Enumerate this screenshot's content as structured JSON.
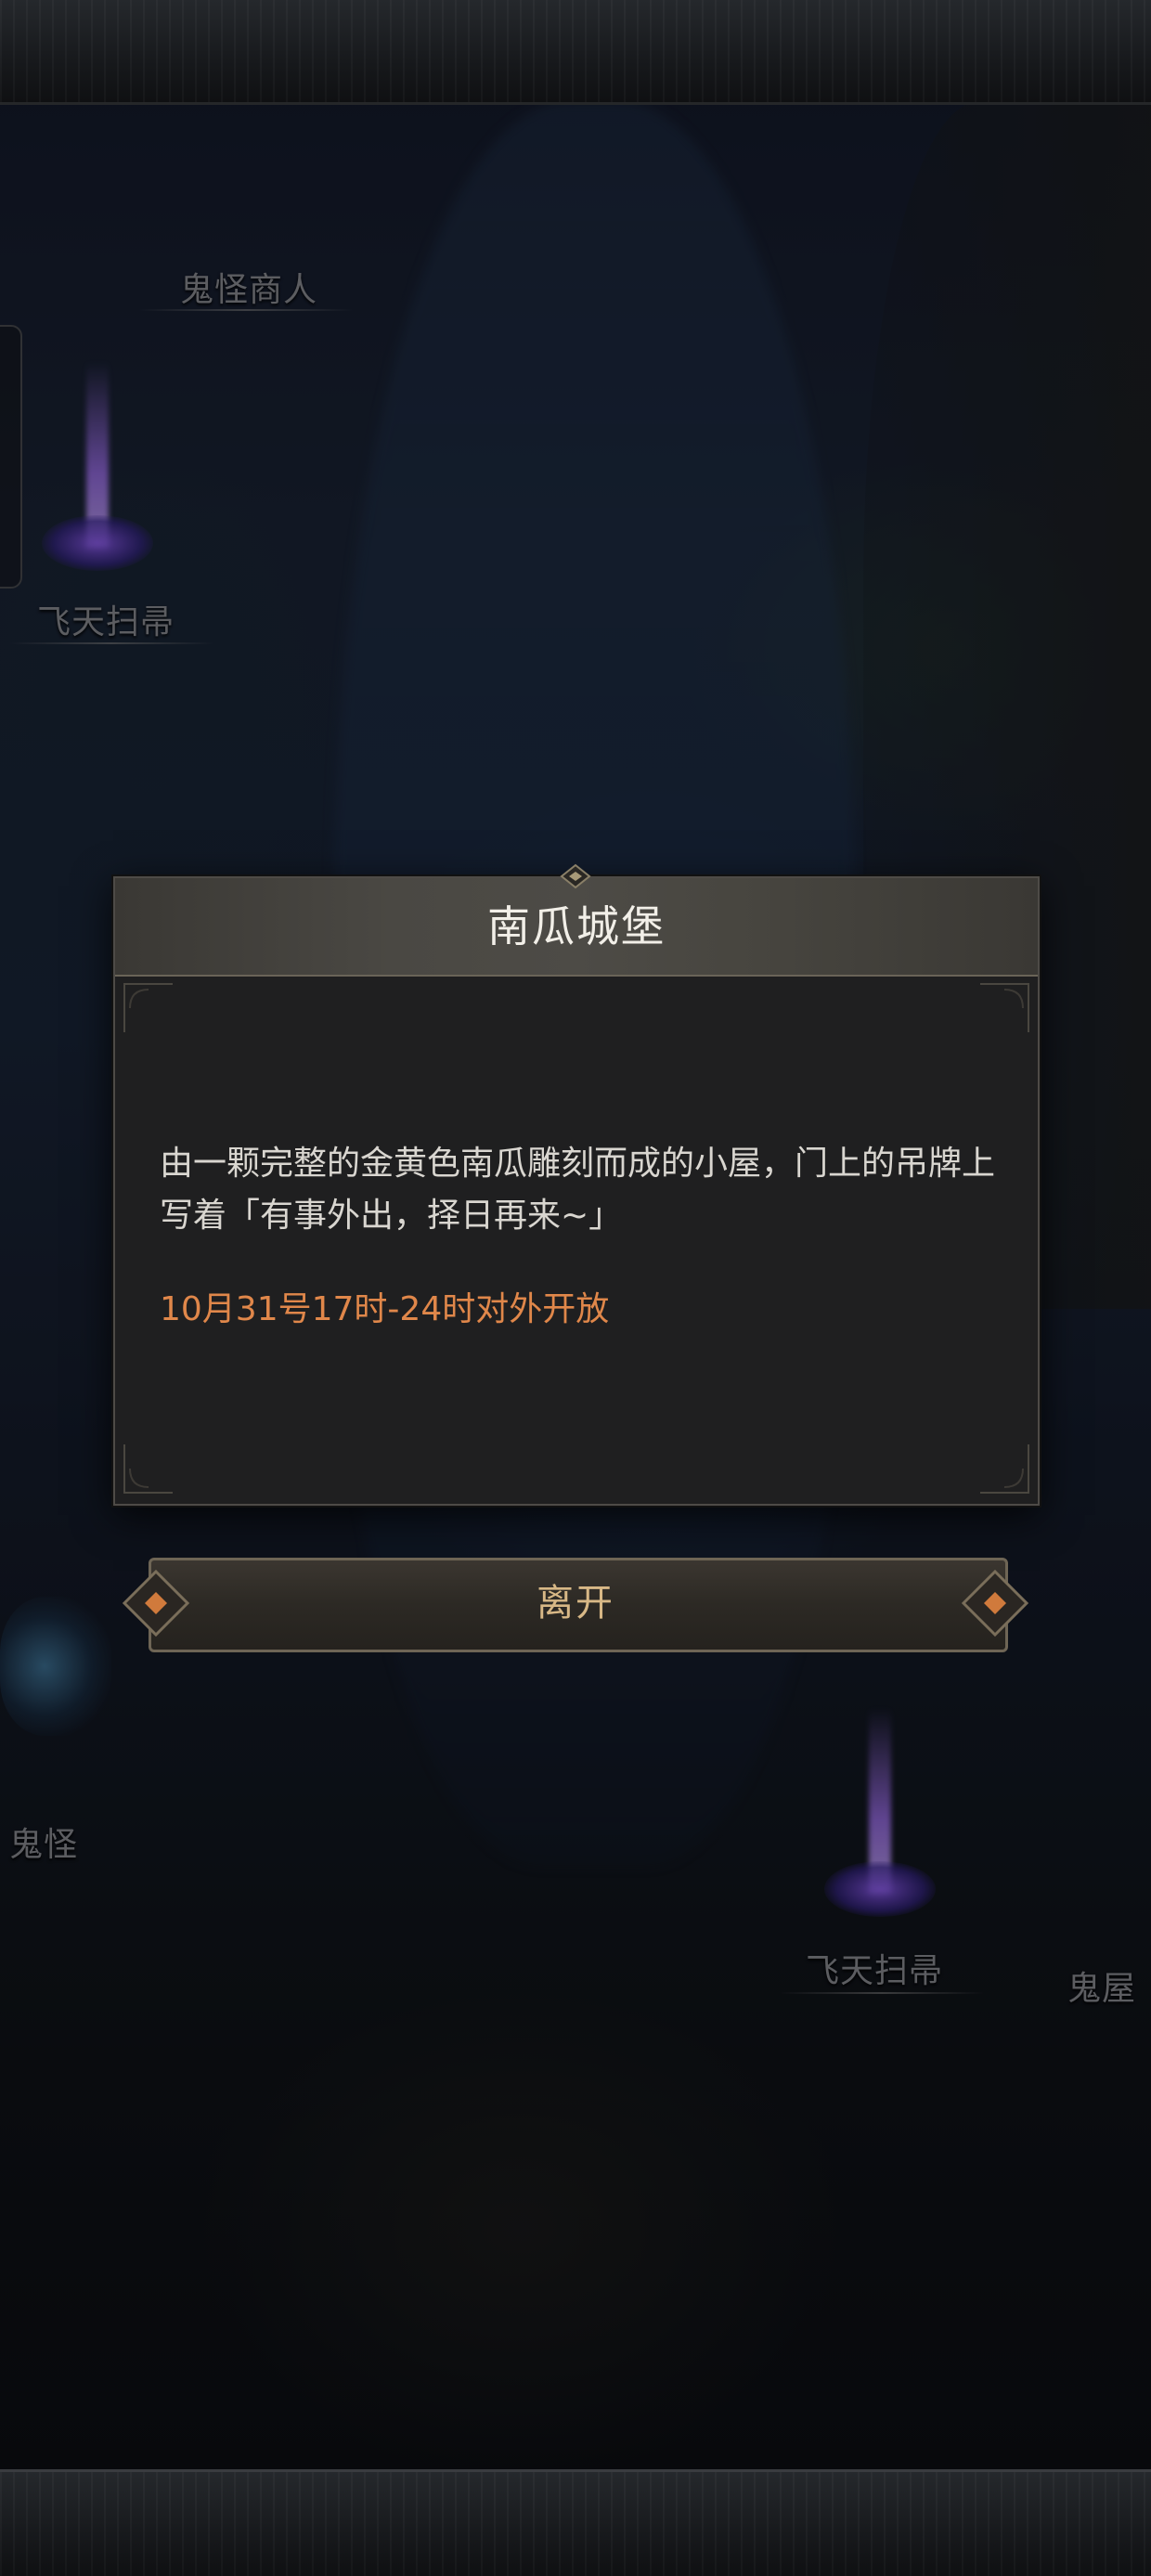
{
  "map": {
    "labels": {
      "ghost_merchant": "鬼怪商人",
      "flying_broom_left": "飞天扫帚",
      "ghost_left": "鬼怪",
      "flying_broom_right": "飞天扫帚",
      "haunted_house": "鬼屋"
    }
  },
  "dialog": {
    "title": "南瓜城堡",
    "description": "由一颗完整的金黄色南瓜雕刻而成的小屋，门上的吊牌上写着「有事外出，择日再来~」",
    "notice": "10月31号17时-24时对外开放",
    "notice_color": "#e0874a"
  },
  "actions": {
    "leave_label": "离开"
  },
  "colors": {
    "accent_gold": "#d8b886",
    "title_text": "#f2efe8",
    "body_text": "#d9d6d0"
  }
}
